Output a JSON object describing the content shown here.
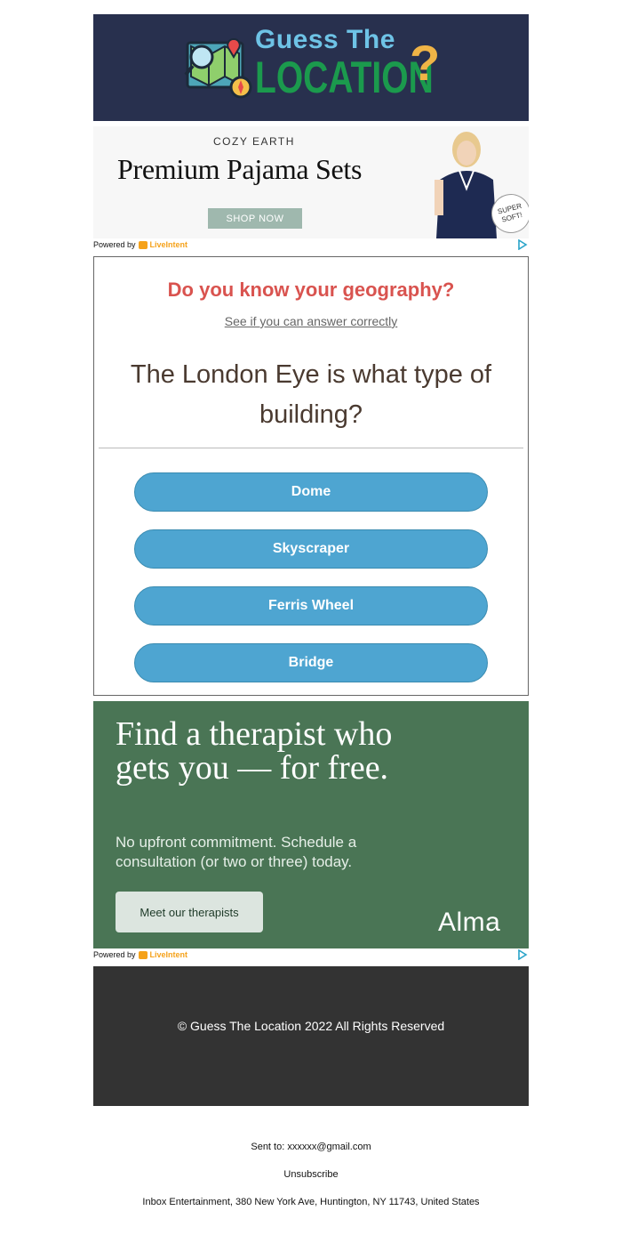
{
  "header": {
    "logo_line1": "Guess The",
    "logo_line2": "LOCATION",
    "logo_qmark": "?"
  },
  "ad1": {
    "brand": "COZY EARTH",
    "headline": "Premium Pajama Sets",
    "cta": "SHOP NOW",
    "badge": "SUPER SOFT!"
  },
  "powered_by": {
    "label": "Powered by",
    "brand": "LiveIntent"
  },
  "quiz": {
    "title": "Do you know your geography?",
    "subtitle": "See if you can answer correctly",
    "question": "The London Eye is what type of building?",
    "answers": [
      "Dome",
      "Skyscraper",
      "Ferris Wheel",
      "Bridge"
    ]
  },
  "ad2": {
    "headline": "Find a therapist who gets you — for free.",
    "body": "No upfront commitment. Schedule a consultation (or two or three) today.",
    "cta": "Meet our therapists",
    "logo": "Alma"
  },
  "footer": {
    "copyright": "© Guess The Location 2022 All Rights Reserved"
  },
  "meta": {
    "sent_to": "Sent to: xxxxxx@gmail.com",
    "unsubscribe": "Unsubscribe",
    "address": "Inbox Entertainment, 380 New York Ave, Huntington, NY 11743, United States"
  },
  "colors": {
    "header_bg": "#28304e",
    "quiz_title": "#d9534f",
    "answer_button": "#4ea5d1",
    "ad2_bg": "#4a7555",
    "footer_bg": "#333333"
  }
}
